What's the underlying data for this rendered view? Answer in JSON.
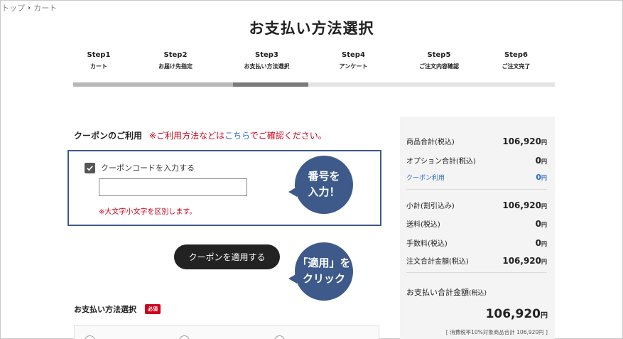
{
  "breadcrumb": {
    "home": "トップ",
    "current": "カート"
  },
  "page_title": "お支払い方法選択",
  "steps": [
    {
      "num": "Step1",
      "label": "カート"
    },
    {
      "num": "Step2",
      "label": "お届け先指定"
    },
    {
      "num": "Step3",
      "label": "お支払い方法選択"
    },
    {
      "num": "Step4",
      "label": "アンケート"
    },
    {
      "num": "Step5",
      "label": "ご注文内容確認"
    },
    {
      "num": "Step6",
      "label": "ご注文完了"
    }
  ],
  "coupon": {
    "title": "クーポンのご利用",
    "note_before": "※ご利用方法などは",
    "note_link": "こちら",
    "note_after": "でご確認ください。",
    "checkbox_label": "クーポンコードを入力する",
    "checked": true,
    "input_value": "",
    "case_note": "※大文字小文字を区別します。",
    "apply_button": "クーポンを適用する"
  },
  "callouts": {
    "enter_number": "番号を\n入力！",
    "click_apply": "「適用」を\nクリック"
  },
  "payment": {
    "title": "お支払い方法選択",
    "required_badge": "必須"
  },
  "summary": {
    "yen": "円",
    "rows": [
      {
        "label": "商品合計",
        "tax": "(税込)",
        "value": "106,920"
      },
      {
        "label": "オプション合計",
        "tax": "(税込)",
        "value": "0"
      },
      {
        "label": "クーポン利用",
        "tax": "",
        "value": "0"
      },
      {
        "label": "小計",
        "tax": "(割引込み)",
        "value": "106,920"
      },
      {
        "label": "送料",
        "tax": "(税込)",
        "value": "0"
      },
      {
        "label": "手数料",
        "tax": "(税込)",
        "value": "0"
      },
      {
        "label": "注文合計金額",
        "tax": "(税込)",
        "value": "106,920"
      }
    ],
    "grand_label": "お支払い合計金額",
    "grand_tax": "(税込)",
    "grand_value": "106,920",
    "tax_note": "[ 消費税率10%対象商品合計 106,920円 ]"
  },
  "colors": {
    "accent_navy": "#3d5a8a",
    "red": "#d0021b",
    "link_blue": "#2a6acb"
  }
}
